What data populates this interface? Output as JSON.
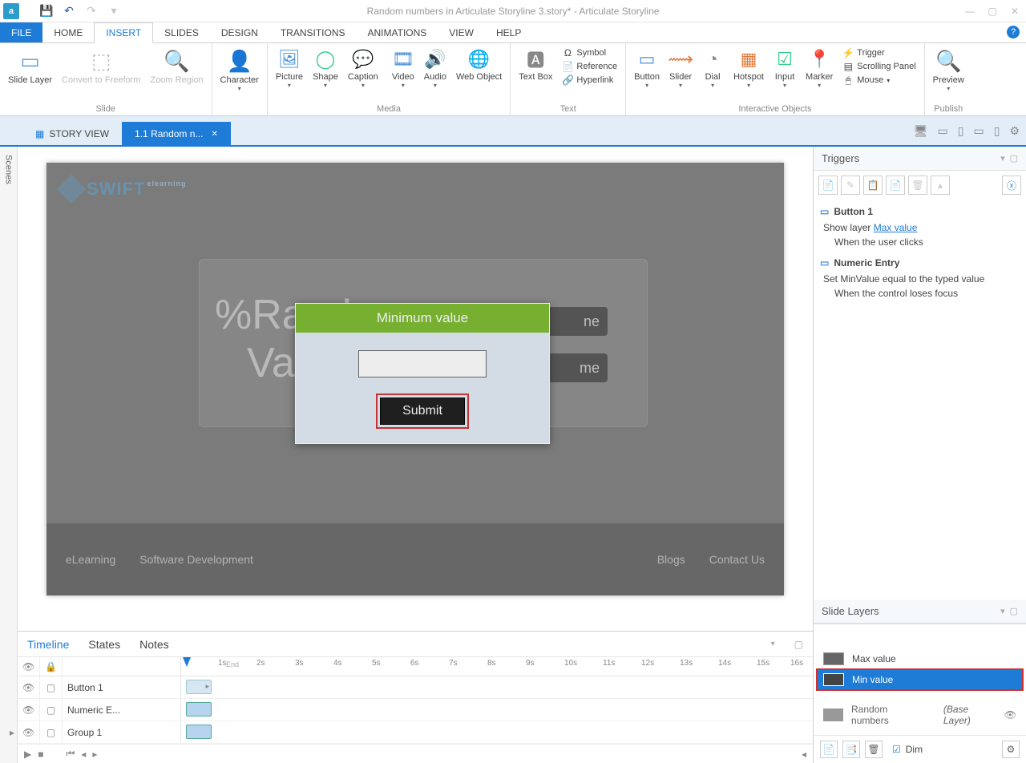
{
  "titlebar": {
    "app_icon_letter": "a",
    "title": "Random numbers in Articulate Storyline 3.story* - Articulate Storyline"
  },
  "menu": {
    "tabs": [
      "FILE",
      "HOME",
      "INSERT",
      "SLIDES",
      "DESIGN",
      "TRANSITIONS",
      "ANIMATIONS",
      "VIEW",
      "HELP"
    ],
    "active": "INSERT"
  },
  "ribbon": {
    "groups": [
      {
        "label": "Slide",
        "items": [
          {
            "lbl": "Slide Layer"
          },
          {
            "lbl": "Convert to Freeform",
            "disabled": true
          },
          {
            "lbl": "Zoom Region",
            "disabled": true
          }
        ]
      },
      {
        "label": "",
        "items": [
          {
            "lbl": "Character"
          }
        ]
      },
      {
        "label": "Media",
        "items": [
          {
            "lbl": "Picture"
          },
          {
            "lbl": "Shape"
          },
          {
            "lbl": "Caption"
          },
          {
            "lbl": "Video"
          },
          {
            "lbl": "Audio"
          },
          {
            "lbl": "Web Object"
          }
        ],
        "sep": true
      },
      {
        "label": "Text",
        "items": [
          {
            "lbl": "Text Box"
          }
        ],
        "small": [
          {
            "lbl": "Symbol"
          },
          {
            "lbl": "Reference"
          },
          {
            "lbl": "Hyperlink"
          }
        ]
      },
      {
        "label": "Interactive Objects",
        "items": [
          {
            "lbl": "Button"
          },
          {
            "lbl": "Slider"
          },
          {
            "lbl": "Dial"
          },
          {
            "lbl": "Hotspot"
          },
          {
            "lbl": "Input"
          },
          {
            "lbl": "Marker"
          }
        ],
        "small": [
          {
            "lbl": "Trigger"
          },
          {
            "lbl": "Scrolling Panel"
          },
          {
            "lbl": "Mouse"
          }
        ]
      },
      {
        "label": "Publish",
        "items": [
          {
            "lbl": "Preview"
          }
        ]
      }
    ]
  },
  "viewtabs": {
    "story_view": "STORY VIEW",
    "active_tab": "1.1 Random n..."
  },
  "scenes_rail": "Scenes",
  "slide": {
    "logo": "SWIFT",
    "logo_sup": "elearning",
    "bigtext": "%Random",
    "bigtext2": "Va",
    "side1": "ne",
    "side2": "me",
    "dialog_title": "Minimum value",
    "submit": "Submit",
    "footer1": "eLearning",
    "footer2": "Software Development",
    "footer3": "Blogs",
    "footer4": "Contact Us"
  },
  "triggers": {
    "title": "Triggers",
    "obj1": "Button 1",
    "rule1_pre": "Show layer ",
    "rule1_link": "Max value",
    "when1": "When the user clicks",
    "obj2": "Numeric Entry",
    "rule2": "Set MinValue equal to the typed value",
    "when2": "When the control loses focus"
  },
  "slidelayers": {
    "title": "Slide Layers",
    "layers": [
      {
        "name": "Max value"
      },
      {
        "name": "Min value",
        "selected": true
      }
    ],
    "base_name": "Random numbers",
    "base_tag": "(Base Layer)",
    "dim_label": "Dim"
  },
  "timeline": {
    "tabs": [
      "Timeline",
      "States",
      "Notes"
    ],
    "active": "Timeline",
    "seconds": [
      "1s",
      "2s",
      "3s",
      "4s",
      "5s",
      "6s",
      "7s",
      "8s",
      "9s",
      "10s",
      "11s",
      "12s",
      "13s",
      "14s",
      "15s",
      "16s"
    ],
    "end": "End",
    "rows": [
      {
        "name": "Button 1"
      },
      {
        "name": "Numeric E...",
        "sel": true
      },
      {
        "name": "Group 1"
      }
    ]
  }
}
